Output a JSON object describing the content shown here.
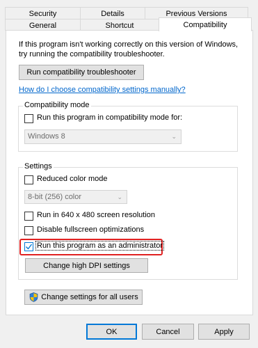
{
  "tabs": {
    "row1": [
      "Security",
      "Details",
      "Previous Versions"
    ],
    "row2": [
      "General",
      "Shortcut",
      "Compatibility"
    ]
  },
  "intro": {
    "line1": "If this program isn't working correctly on this version of Windows,",
    "line2": "try running the compatibility troubleshooter."
  },
  "buttons": {
    "troubleshooter": "Run compatibility troubleshooter",
    "dpi": "Change high DPI settings",
    "all_users": "Change settings for all users",
    "ok": "OK",
    "cancel": "Cancel",
    "apply": "Apply"
  },
  "help_link": "How do I choose compatibility settings manually?",
  "compat_mode": {
    "legend": "Compatibility mode",
    "checkbox_label": "Run this program in compatibility mode for:",
    "checked": false,
    "select_value": "Windows 8"
  },
  "settings": {
    "legend": "Settings",
    "reduced_color": {
      "label": "Reduced color mode",
      "checked": false
    },
    "color_select_value": "8-bit (256) color",
    "run_640": {
      "label": "Run in 640 x 480 screen resolution",
      "checked": false
    },
    "disable_fullscreen": {
      "label": "Disable fullscreen optimizations",
      "checked": false
    },
    "run_admin": {
      "label": "Run this program as an administrator",
      "checked": true
    }
  },
  "colors": {
    "accent": "#0078d7",
    "link": "#0066cc",
    "highlight": "#e02020"
  }
}
